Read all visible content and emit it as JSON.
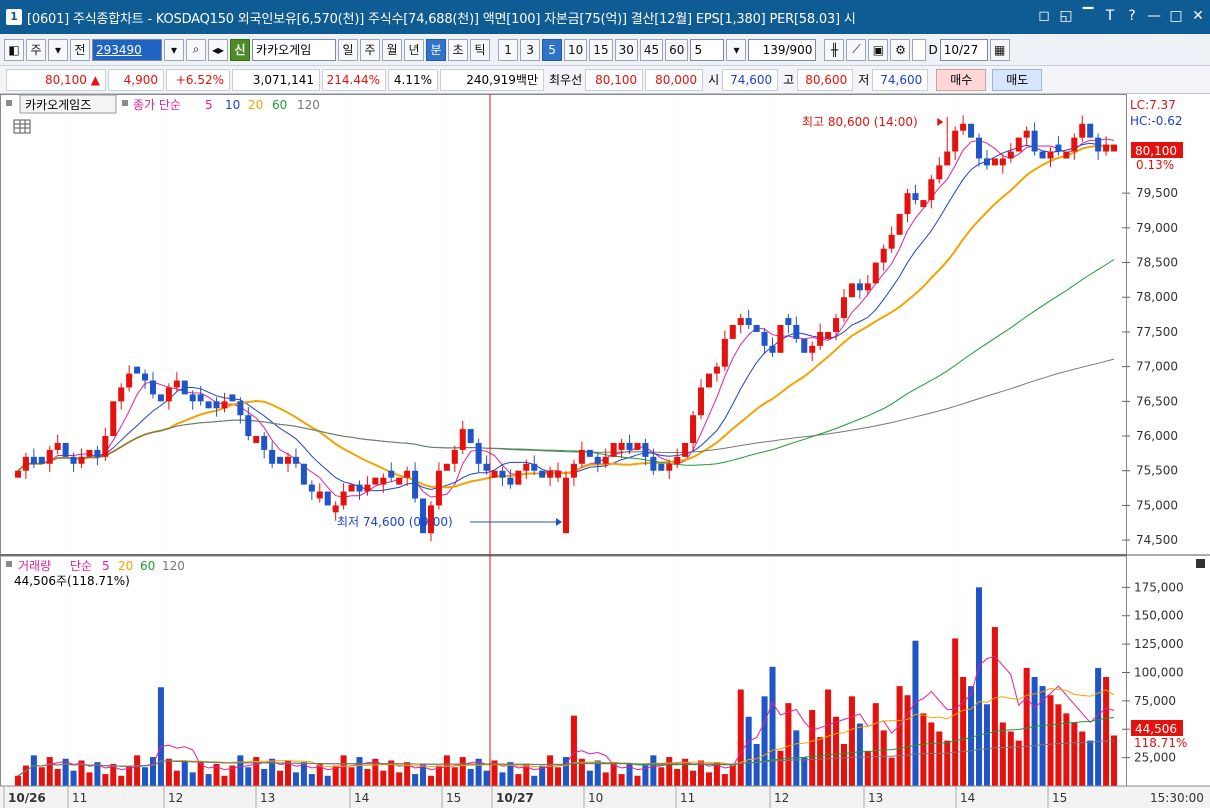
{
  "titlebar": {
    "window_number": "1",
    "text": "[0601] 주식종합차트 - KOSDAQ150 외국인보유[6,570(천)] 주식수[74,688(천)] 액면[100] 자본금[75(억)] 결산[12월] EPS[1,380] PER[58.03] 시",
    "controls": [
      "◻",
      "◱",
      "▔",
      "T",
      "?",
      "|",
      "—",
      "□",
      "✕"
    ]
  },
  "toolbar": {
    "market_label": "주",
    "all_label": "전",
    "stock_code": "293490",
    "credit_badge": "신",
    "stock_name": "카카오게임",
    "period_buttons": [
      "일",
      "주",
      "월",
      "년",
      "분",
      "초",
      "틱"
    ],
    "active_period": "분",
    "interval_buttons": [
      "1",
      "3",
      "5",
      "10",
      "15",
      "30",
      "45",
      "60"
    ],
    "active_interval": "5",
    "interval_select": "5",
    "count_value": "139",
    "count_total": "/900",
    "date_check_label": "D",
    "date_value": "10/27"
  },
  "quote": {
    "price": "80,100",
    "arrow": "▲",
    "change": "4,900",
    "change_pct": "+6.52%",
    "volume": "3,071,141",
    "volume_ratio": "214.44%",
    "turnover": "4.11%",
    "amount": "240,919백만",
    "best_label": "최우선",
    "best_ask": "80,100",
    "best_bid": "80,000",
    "open_label": "시",
    "open": "74,600",
    "high_label": "고",
    "high": "80,600",
    "low_label": "저",
    "low": "74,600",
    "buy_label": "매수",
    "sell_label": "매도"
  },
  "colors": {
    "up": "#e4120f",
    "down": "#1f55c6",
    "ma5": "#e0209f",
    "ma10": "#1f3fd0",
    "ma20": "#f0a500",
    "ma60": "#1d9a35",
    "ma120": "#777777"
  },
  "legend": {
    "price_title": "카카오게임즈",
    "price_ma_label": "종가 단순",
    "volume_title": "거래량",
    "volume_ma_label": "단순",
    "volume_current": "44,506주(118.71%)"
  },
  "annotations": {
    "high_text": "최고 80,600 (14:00)",
    "low_text": "최저 74,600 (09:00)",
    "lc": "LC:7.37",
    "hc": "HC:-0.62",
    "price_tag": "80,100",
    "price_tag_pct": "0.13%",
    "volume_tag": "44,506",
    "volume_tag_pct": "118.71%"
  },
  "chart_data": [
    {
      "type": "candlestick",
      "title": "카카오게임즈",
      "ma_periods": [
        5,
        10,
        20,
        60,
        120
      ],
      "ylim": [
        74300,
        80900
      ],
      "y_ticks": [
        74500,
        75000,
        75500,
        76000,
        76500,
        77000,
        77500,
        78000,
        78500,
        79000,
        79500
      ],
      "y_tick_labels": [
        "74,500",
        "75,000",
        "75,500",
        "76,000",
        "76,500",
        "77,000",
        "77,500",
        "78,000",
        "78,500",
        "79,000",
        "79,500"
      ],
      "x_labels": [
        "10/26",
        "11",
        "12",
        "13",
        "14",
        "15",
        "10/27",
        "10",
        "11",
        "12",
        "13",
        "14",
        "15",
        "15:30:00"
      ],
      "close_path": [
        75400,
        75600,
        75800,
        75900,
        75700,
        75500,
        75800,
        76000,
        76600,
        76900,
        76800,
        76700,
        76600,
        76700,
        76500,
        76400,
        76500,
        76500,
        76300,
        76000,
        75800,
        75700,
        75600,
        75400,
        75200,
        75100,
        75100,
        75200,
        75300,
        75400,
        75500,
        75400,
        75300,
        74600,
        75400,
        75700,
        76000,
        75800,
        75600,
        75400,
        75300,
        75500,
        75600,
        75500,
        75400,
        75500,
        75700,
        75800,
        75700,
        75900,
        75800,
        75700,
        75600,
        75500,
        75800,
        76400,
        77000,
        77200,
        77500,
        77800,
        77400,
        77300,
        77600,
        77400,
        77200,
        77400,
        77700,
        77900,
        78100,
        78300,
        78600,
        79000,
        79300,
        79400,
        79600,
        79900,
        80400,
        80300,
        80100,
        79900,
        80000,
        80200,
        80300,
        80200,
        80000,
        80100,
        80300,
        80400,
        80200,
        80100
      ],
      "high_point": {
        "value": 80600,
        "time": "14:00"
      },
      "low_point": {
        "value": 74600,
        "time": "09:00"
      },
      "current_price": 80100
    },
    {
      "type": "bar",
      "title": "거래량",
      "ma_periods": [
        5,
        20,
        60,
        120
      ],
      "ylim": [
        0,
        185000
      ],
      "y_ticks": [
        25000,
        50000,
        75000,
        100000,
        125000,
        150000,
        175000
      ],
      "y_tick_labels": [
        "25,000",
        "50,000",
        "75,000",
        "100,000",
        "125,000",
        "150,000",
        "175,000"
      ],
      "notable_values": [
        87000,
        62000,
        105000,
        128000,
        130000,
        175000,
        140000,
        44506
      ],
      "current_volume": 44506
    }
  ]
}
